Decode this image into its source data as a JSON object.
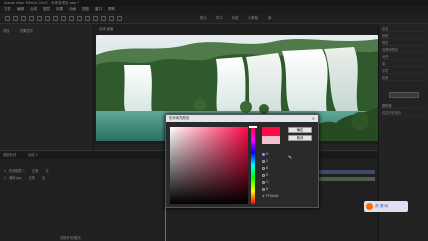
{
  "window": {
    "title": "Adobe After Effects 2020 - 未命名项目.aep *"
  },
  "menu": {
    "items": [
      "文件",
      "编辑",
      "合成",
      "图层",
      "效果",
      "动画",
      "视图",
      "窗口",
      "帮助"
    ]
  },
  "workspaces": [
    "默认",
    "学习",
    "标准",
    "小屏幕",
    "库"
  ],
  "left_panel": {
    "tab_project": "项目",
    "tab_effects": "效果控件"
  },
  "viewer": {
    "tab_label": "合成 画面"
  },
  "right_panel": {
    "rows": [
      "信息",
      "音频",
      "预览",
      "效果和预设",
      "对齐",
      "库",
      "字符",
      "段落",
      "跟踪器",
      "内容识别填充"
    ]
  },
  "timeline": {
    "tab_render": "渲染队列",
    "tab_comp": "合成 1",
    "layers": [
      {
        "num": "1",
        "name": "形状图层 1",
        "mode": "正常",
        "parent": "无"
      },
      {
        "num": "2",
        "name": "瀑布.jpg",
        "mode": "正常",
        "parent": "无"
      }
    ],
    "footer": "切换开关/模式"
  },
  "dialog": {
    "title": "形状填充颜色",
    "ok_label": "确定",
    "cancel_label": "取消",
    "fields": [
      "H",
      "S",
      "B",
      "R",
      "G",
      "B",
      "#"
    ],
    "hex_value": "FF0A48"
  },
  "watermark": {
    "text": "虎 课 网"
  },
  "colors": {
    "new_color": "#ff0a48",
    "current_color": "#f4c1cc",
    "accent": "#3f78d6"
  }
}
